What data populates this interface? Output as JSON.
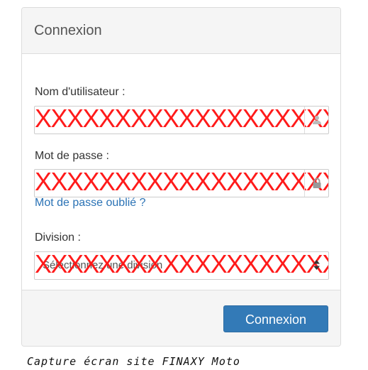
{
  "panel": {
    "title": "Connexion"
  },
  "form": {
    "username_label": "Nom d'utilisateur :",
    "username_value": "XXXXXXXXXXXXXXXXXXX",
    "password_label": "Mot de passe :",
    "password_value": "XXXXXXXXXXXXXXXXXXX",
    "forgot_link": "Mot de passe oublié ?",
    "division_label": "Division :",
    "division_placeholder": "Sélectionnez une division",
    "division_redaction": "XXXXXXXXXXXXXXXXXXX"
  },
  "footer": {
    "submit_label": "Connexion"
  },
  "caption": "Capture écran site FINAXY Moto",
  "colors": {
    "primary_button": "#337ab7",
    "link": "#2a72b5",
    "redaction": "#ff1a1a",
    "heading_bg": "#f5f5f5"
  },
  "icons": {
    "username_addon": "user-icon",
    "password_addon": "lock-icon",
    "select_arrows": "sort-arrows-icon"
  }
}
